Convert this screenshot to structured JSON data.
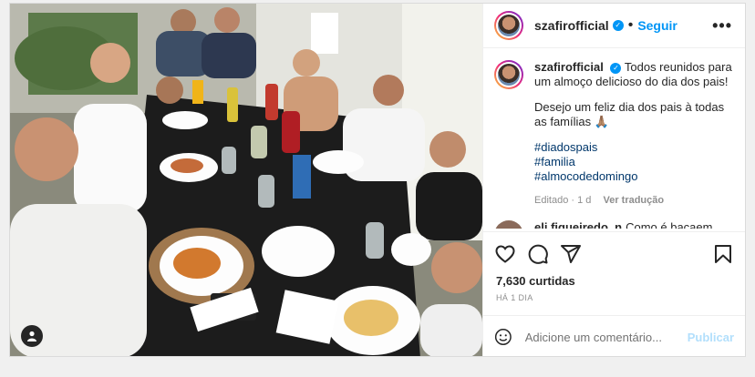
{
  "header": {
    "username": "szafirofficial",
    "separator": "•",
    "follow_label": "Seguir",
    "more_icon": "more-horizontal-icon"
  },
  "caption": {
    "username": "szafirofficial",
    "line1": "Todos reunidos para um almoço delicioso do dia dos pais!",
    "line2": "Desejo um feliz dia dos pais à todas as famílias 🙏🏽",
    "hashtags": [
      "#diadospais",
      "#familia",
      "#almocodedomingo"
    ],
    "edited": "Editado",
    "time": "1 d",
    "translate": "Ver tradução"
  },
  "comment_peek": {
    "username": "eli.figueiredo_n",
    "text": "Como é bacaem"
  },
  "actions": {
    "like_icon": "heart-icon",
    "comment_icon": "comment-icon",
    "share_icon": "send-icon",
    "save_icon": "bookmark-icon"
  },
  "likes": "7,630 curtidas",
  "posted": "HÁ 1 DIA",
  "add_comment": {
    "placeholder": "Adicione um comentário...",
    "publish_label": "Publicar",
    "emoji_icon": "emoji-icon"
  },
  "colors": {
    "accent": "#0095f6",
    "hashtag": "#00376b",
    "muted": "#8e8e8e",
    "publish_disabled": "#b2dffc"
  }
}
